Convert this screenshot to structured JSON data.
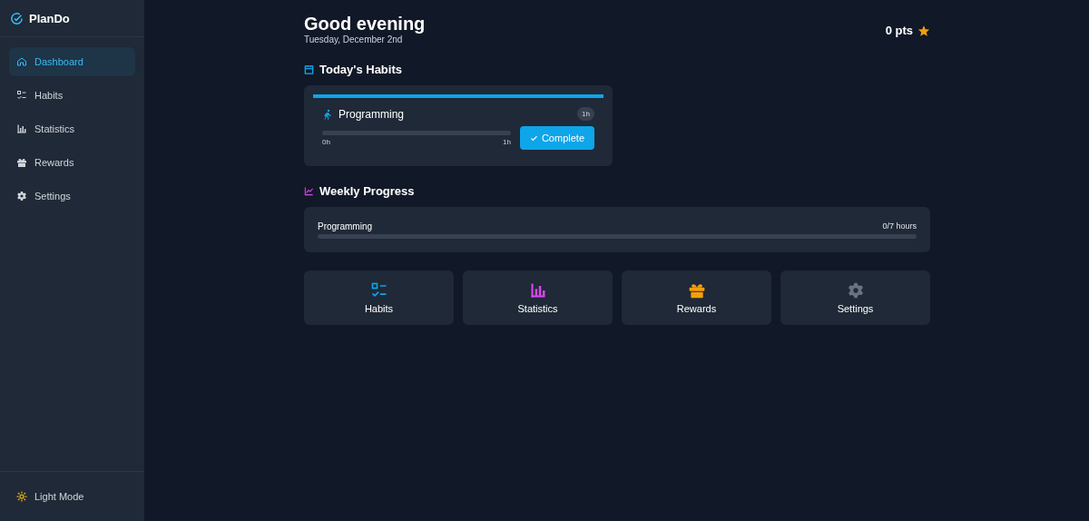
{
  "app": {
    "name": "PlanDo"
  },
  "sidebar": {
    "items": [
      {
        "label": "Dashboard",
        "kind": "home",
        "selected": true
      },
      {
        "label": "Habits",
        "kind": "habits",
        "selected": false
      },
      {
        "label": "Statistics",
        "kind": "statistics",
        "selected": false
      },
      {
        "label": "Rewards",
        "kind": "rewards",
        "selected": false
      },
      {
        "label": "Settings",
        "kind": "settings",
        "selected": false
      }
    ],
    "theme_toggle": {
      "label": "Light Mode"
    }
  },
  "header": {
    "greeting": "Good evening",
    "date": "Tuesday, December 2nd",
    "points": "0 pts"
  },
  "todays_habits": {
    "title": "Today's Habits",
    "habits": [
      {
        "name": "Programming",
        "badge": "1h",
        "level": 0,
        "min_label": "0h",
        "max_label": "1h",
        "button": "Complete"
      }
    ]
  },
  "weekly_progress": {
    "title": "Weekly Progress",
    "rows": [
      {
        "name": "Programming",
        "reading": "0/7 hours",
        "level": 0
      }
    ]
  },
  "quick_links": [
    {
      "label": "Habits",
      "kind": "habits",
      "color": "#0ea5e9"
    },
    {
      "label": "Statistics",
      "kind": "statistics",
      "color": "#d946ef"
    },
    {
      "label": "Rewards",
      "kind": "rewards",
      "color": "#f59e0b"
    },
    {
      "label": "Settings",
      "kind": "settings",
      "color": "#6b7280"
    }
  ]
}
